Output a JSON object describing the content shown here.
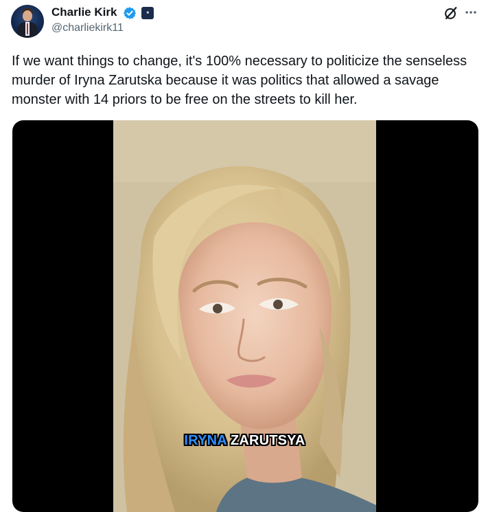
{
  "author": {
    "name": "Charlie Kirk",
    "handle": "@charliekirk11",
    "verified": true,
    "verified_color": "#1d9bf0",
    "affiliation_badge_icon": "organization-badge-icon"
  },
  "header_actions": {
    "grok_icon": "grok-icon",
    "more_icon": "more-options-icon"
  },
  "tweet": {
    "text": "If we want things to change, it's 100% necessary to politicize the senseless murder of Iryna Zarutska because it was politics that allowed a savage monster with 14 priors to be free on the streets to kill her."
  },
  "media": {
    "caption_first": "IRYNA",
    "caption_second": "ZARUTSYA",
    "caption_first_color": "#2f8fff",
    "caption_second_color": "#ffffff"
  },
  "colors": {
    "text_primary": "#0f1419",
    "text_secondary": "#536471",
    "media_background": "#000000"
  }
}
